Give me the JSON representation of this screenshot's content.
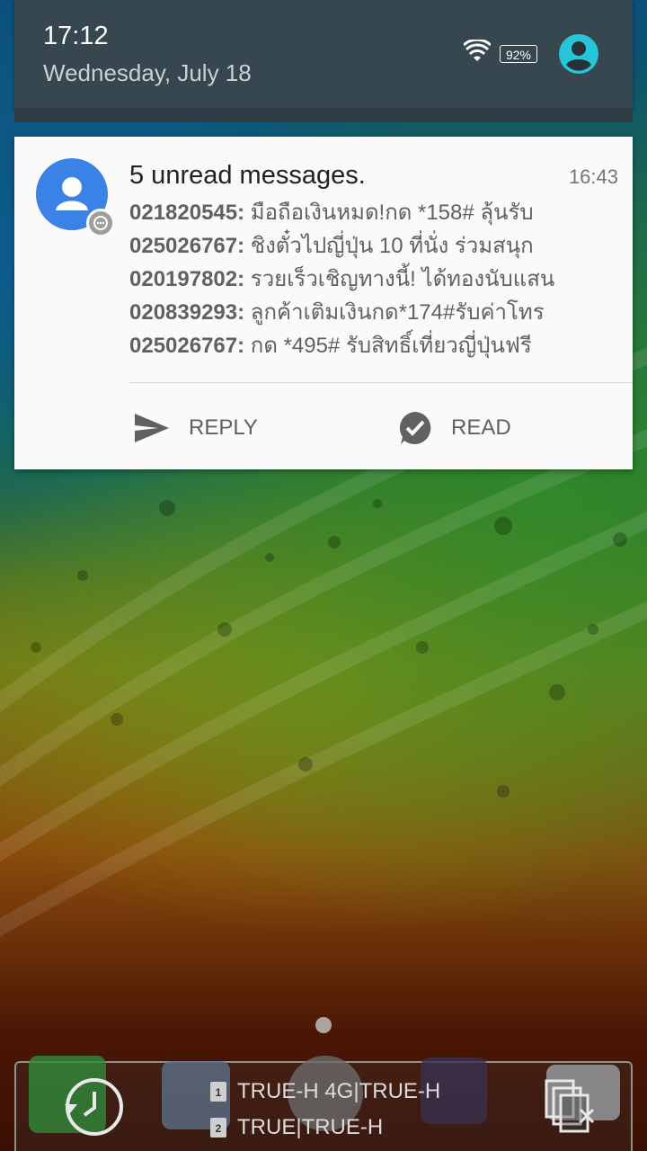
{
  "status": {
    "time": "17:12",
    "date": "Wednesday, July 18",
    "battery": "92%",
    "icons": [
      "wifi-icon",
      "battery-icon",
      "user-account-icon"
    ]
  },
  "notification": {
    "title": "5 unread messages.",
    "time": "16:43",
    "messages": [
      {
        "number": "021820545:",
        "text": "มือถือเงินหมด!กด *158#  ลุ้นรับ"
      },
      {
        "number": "025026767:",
        "text": "ชิงตั๋วไปญี่ปุ่น 10 ที่นั่ง ร่วมสนุก"
      },
      {
        "number": "020197802:",
        "text": "รวยเร็วเชิญทางนี้! ได้ทองนับแสน"
      },
      {
        "number": "020839293:",
        "text": "ลูกค้าเติมเงินกด*174#รับค่าโทร"
      },
      {
        "number": "025026767:",
        "text": "กด *495# รับสิทธิ์เที่ยวญี่ปุ่นฟรี"
      }
    ],
    "actions": {
      "reply": "REPLY",
      "read": "READ"
    }
  },
  "dock": {
    "sim1_label": "1",
    "sim2_label": "2",
    "sim1": "TRUE-H 4G|TRUE-H",
    "sim2": "TRUE|TRUE-H"
  },
  "colors": {
    "shade": "#37474f",
    "avatar": "#3b82e6",
    "accent_user": "#26c6da"
  }
}
